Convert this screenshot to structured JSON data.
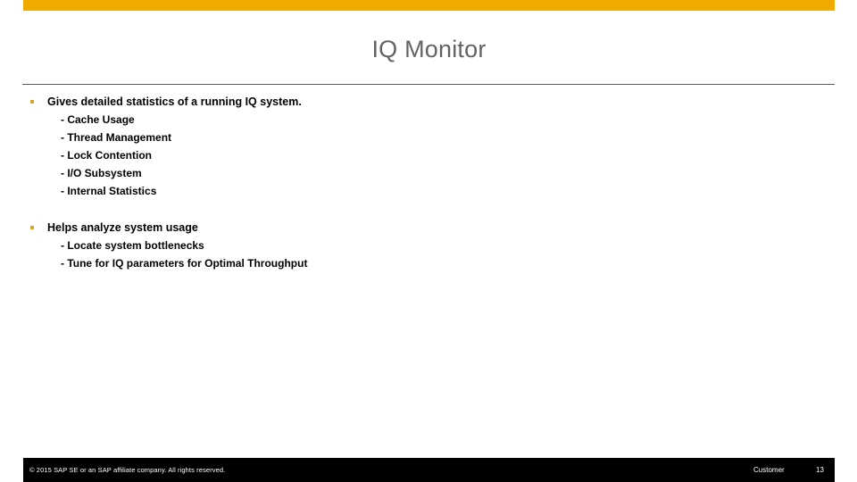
{
  "theme": {
    "accent_color": "#f0ab00",
    "bullet_color": "#d6a62a",
    "title_color": "#636363",
    "footer_background": "#000000",
    "footer_text_color": "#ffffff",
    "body_text_color": "#000000"
  },
  "slide": {
    "title": "IQ Monitor",
    "bullets": [
      {
        "text": "Gives detailed statistics of a running IQ system.",
        "subitems": [
          "- Cache Usage",
          "- Thread Management",
          "- Lock Contention",
          "- I/O Subsystem",
          "- Internal Statistics"
        ]
      },
      {
        "text": "Helps analyze system usage",
        "subitems": [
          "- Locate system bottlenecks",
          "- Tune for IQ parameters for Optimal Throughput"
        ]
      }
    ]
  },
  "footer": {
    "copyright": "© 2015 SAP SE or an SAP affiliate company. All rights reserved.",
    "audience": "Customer",
    "page_number": "13"
  }
}
